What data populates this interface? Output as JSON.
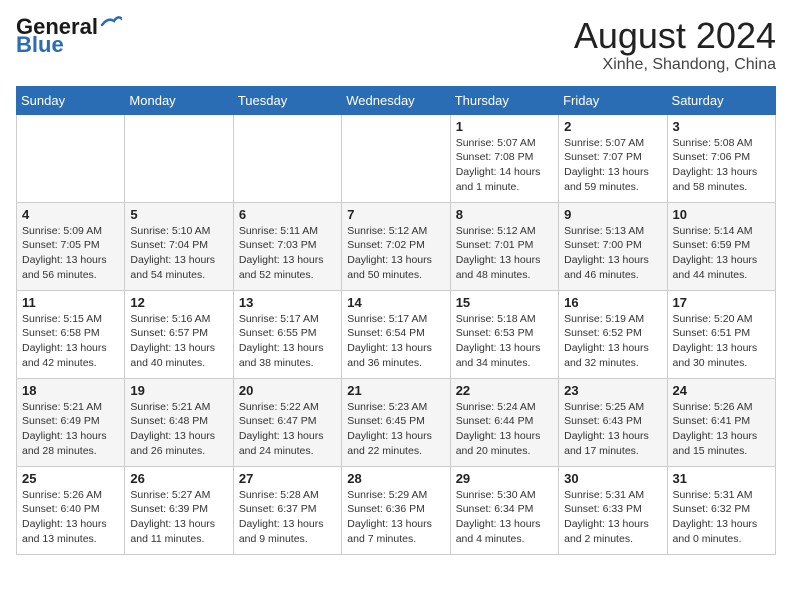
{
  "header": {
    "logo_line1": "General",
    "logo_line2": "Blue",
    "month_year": "August 2024",
    "location": "Xinhe, Shandong, China"
  },
  "weekdays": [
    "Sunday",
    "Monday",
    "Tuesday",
    "Wednesday",
    "Thursday",
    "Friday",
    "Saturday"
  ],
  "weeks": [
    [
      {
        "day": "",
        "info": ""
      },
      {
        "day": "",
        "info": ""
      },
      {
        "day": "",
        "info": ""
      },
      {
        "day": "",
        "info": ""
      },
      {
        "day": "1",
        "info": "Sunrise: 5:07 AM\nSunset: 7:08 PM\nDaylight: 14 hours\nand 1 minute."
      },
      {
        "day": "2",
        "info": "Sunrise: 5:07 AM\nSunset: 7:07 PM\nDaylight: 13 hours\nand 59 minutes."
      },
      {
        "day": "3",
        "info": "Sunrise: 5:08 AM\nSunset: 7:06 PM\nDaylight: 13 hours\nand 58 minutes."
      }
    ],
    [
      {
        "day": "4",
        "info": "Sunrise: 5:09 AM\nSunset: 7:05 PM\nDaylight: 13 hours\nand 56 minutes."
      },
      {
        "day": "5",
        "info": "Sunrise: 5:10 AM\nSunset: 7:04 PM\nDaylight: 13 hours\nand 54 minutes."
      },
      {
        "day": "6",
        "info": "Sunrise: 5:11 AM\nSunset: 7:03 PM\nDaylight: 13 hours\nand 52 minutes."
      },
      {
        "day": "7",
        "info": "Sunrise: 5:12 AM\nSunset: 7:02 PM\nDaylight: 13 hours\nand 50 minutes."
      },
      {
        "day": "8",
        "info": "Sunrise: 5:12 AM\nSunset: 7:01 PM\nDaylight: 13 hours\nand 48 minutes."
      },
      {
        "day": "9",
        "info": "Sunrise: 5:13 AM\nSunset: 7:00 PM\nDaylight: 13 hours\nand 46 minutes."
      },
      {
        "day": "10",
        "info": "Sunrise: 5:14 AM\nSunset: 6:59 PM\nDaylight: 13 hours\nand 44 minutes."
      }
    ],
    [
      {
        "day": "11",
        "info": "Sunrise: 5:15 AM\nSunset: 6:58 PM\nDaylight: 13 hours\nand 42 minutes."
      },
      {
        "day": "12",
        "info": "Sunrise: 5:16 AM\nSunset: 6:57 PM\nDaylight: 13 hours\nand 40 minutes."
      },
      {
        "day": "13",
        "info": "Sunrise: 5:17 AM\nSunset: 6:55 PM\nDaylight: 13 hours\nand 38 minutes."
      },
      {
        "day": "14",
        "info": "Sunrise: 5:17 AM\nSunset: 6:54 PM\nDaylight: 13 hours\nand 36 minutes."
      },
      {
        "day": "15",
        "info": "Sunrise: 5:18 AM\nSunset: 6:53 PM\nDaylight: 13 hours\nand 34 minutes."
      },
      {
        "day": "16",
        "info": "Sunrise: 5:19 AM\nSunset: 6:52 PM\nDaylight: 13 hours\nand 32 minutes."
      },
      {
        "day": "17",
        "info": "Sunrise: 5:20 AM\nSunset: 6:51 PM\nDaylight: 13 hours\nand 30 minutes."
      }
    ],
    [
      {
        "day": "18",
        "info": "Sunrise: 5:21 AM\nSunset: 6:49 PM\nDaylight: 13 hours\nand 28 minutes."
      },
      {
        "day": "19",
        "info": "Sunrise: 5:21 AM\nSunset: 6:48 PM\nDaylight: 13 hours\nand 26 minutes."
      },
      {
        "day": "20",
        "info": "Sunrise: 5:22 AM\nSunset: 6:47 PM\nDaylight: 13 hours\nand 24 minutes."
      },
      {
        "day": "21",
        "info": "Sunrise: 5:23 AM\nSunset: 6:45 PM\nDaylight: 13 hours\nand 22 minutes."
      },
      {
        "day": "22",
        "info": "Sunrise: 5:24 AM\nSunset: 6:44 PM\nDaylight: 13 hours\nand 20 minutes."
      },
      {
        "day": "23",
        "info": "Sunrise: 5:25 AM\nSunset: 6:43 PM\nDaylight: 13 hours\nand 17 minutes."
      },
      {
        "day": "24",
        "info": "Sunrise: 5:26 AM\nSunset: 6:41 PM\nDaylight: 13 hours\nand 15 minutes."
      }
    ],
    [
      {
        "day": "25",
        "info": "Sunrise: 5:26 AM\nSunset: 6:40 PM\nDaylight: 13 hours\nand 13 minutes."
      },
      {
        "day": "26",
        "info": "Sunrise: 5:27 AM\nSunset: 6:39 PM\nDaylight: 13 hours\nand 11 minutes."
      },
      {
        "day": "27",
        "info": "Sunrise: 5:28 AM\nSunset: 6:37 PM\nDaylight: 13 hours\nand 9 minutes."
      },
      {
        "day": "28",
        "info": "Sunrise: 5:29 AM\nSunset: 6:36 PM\nDaylight: 13 hours\nand 7 minutes."
      },
      {
        "day": "29",
        "info": "Sunrise: 5:30 AM\nSunset: 6:34 PM\nDaylight: 13 hours\nand 4 minutes."
      },
      {
        "day": "30",
        "info": "Sunrise: 5:31 AM\nSunset: 6:33 PM\nDaylight: 13 hours\nand 2 minutes."
      },
      {
        "day": "31",
        "info": "Sunrise: 5:31 AM\nSunset: 6:32 PM\nDaylight: 13 hours\nand 0 minutes."
      }
    ]
  ]
}
